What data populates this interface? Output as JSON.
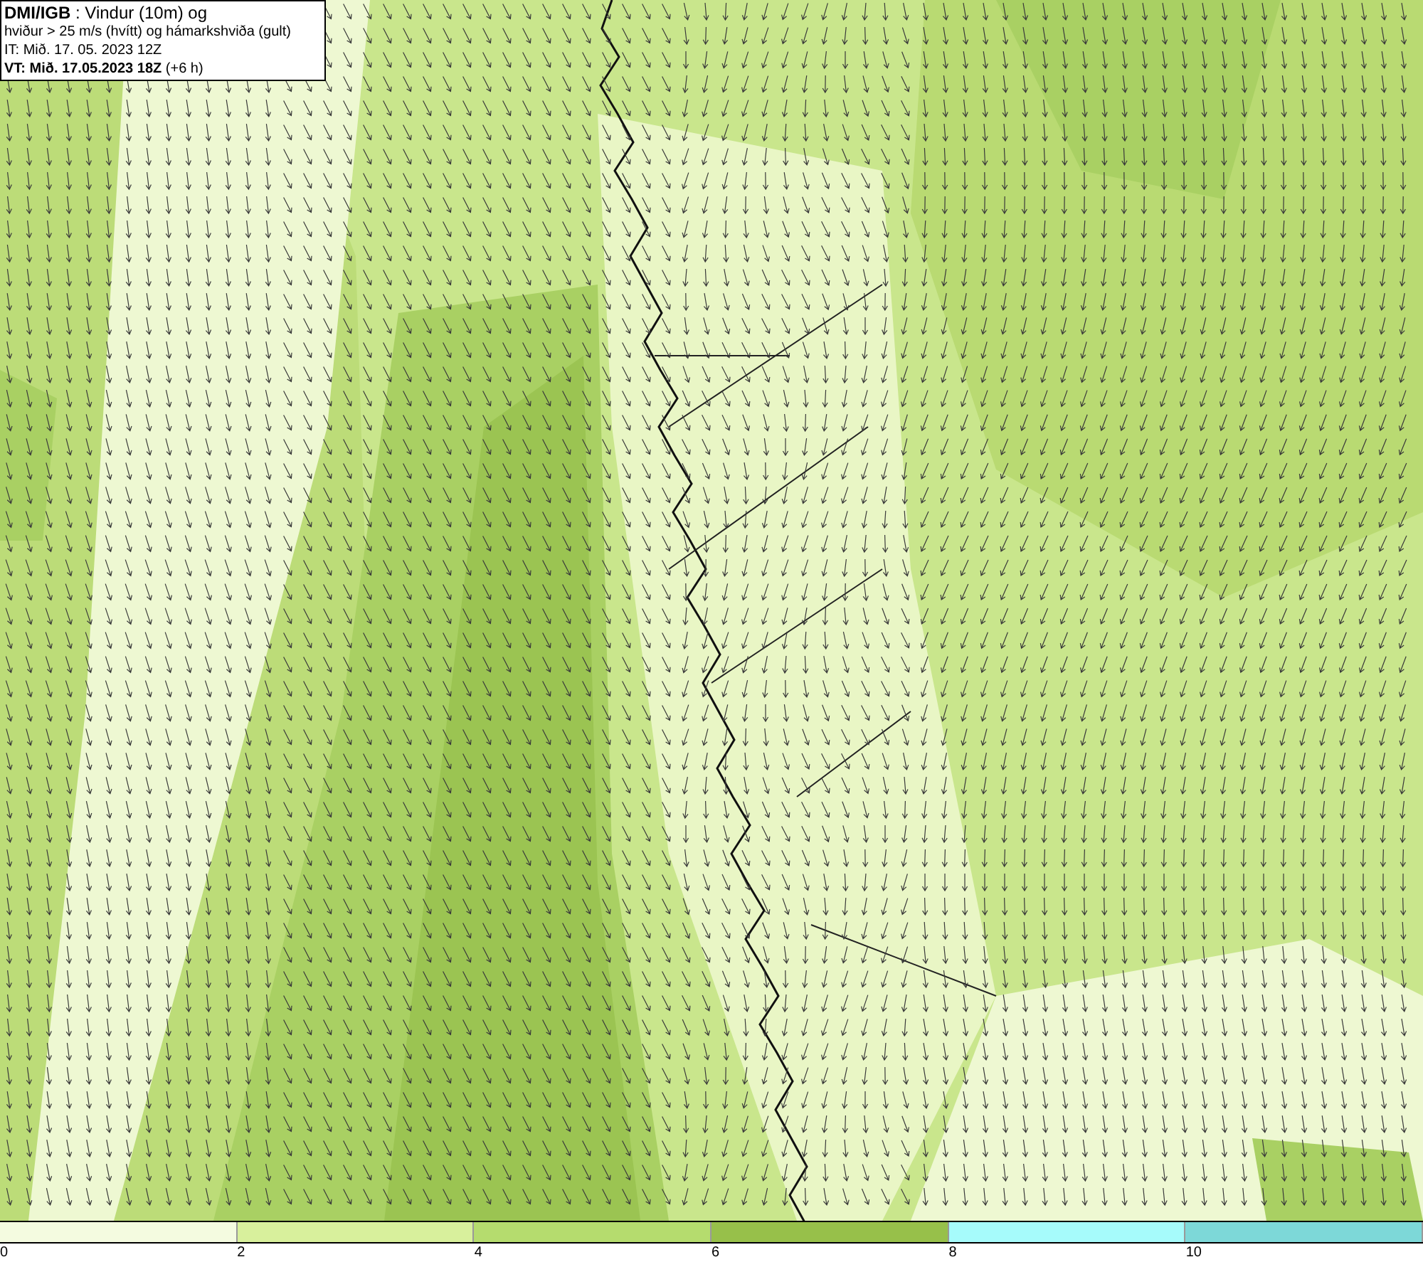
{
  "header": {
    "lines": [
      "**DMI/IGB** : Vindur (10m) og",
      "hviður > 25 m/s (hvítt) og hámarkshviða (gult)",
      "IT: Mið. 17. 05. 2023 12Z",
      "**VT: Mið. 17.05.2023 18Z** (+6 h)"
    ]
  },
  "legend": [
    {
      "label": "0",
      "color": "#f4fbe0"
    },
    {
      "label": "2",
      "color": "#d8f09c"
    },
    {
      "label": "4",
      "color": "#b5dc6e"
    },
    {
      "label": "6",
      "color": "#97c04a"
    },
    {
      "label": "8",
      "color": "#a6fbfb"
    },
    {
      "label": "10",
      "color": "#7dd8d8"
    }
  ]
}
